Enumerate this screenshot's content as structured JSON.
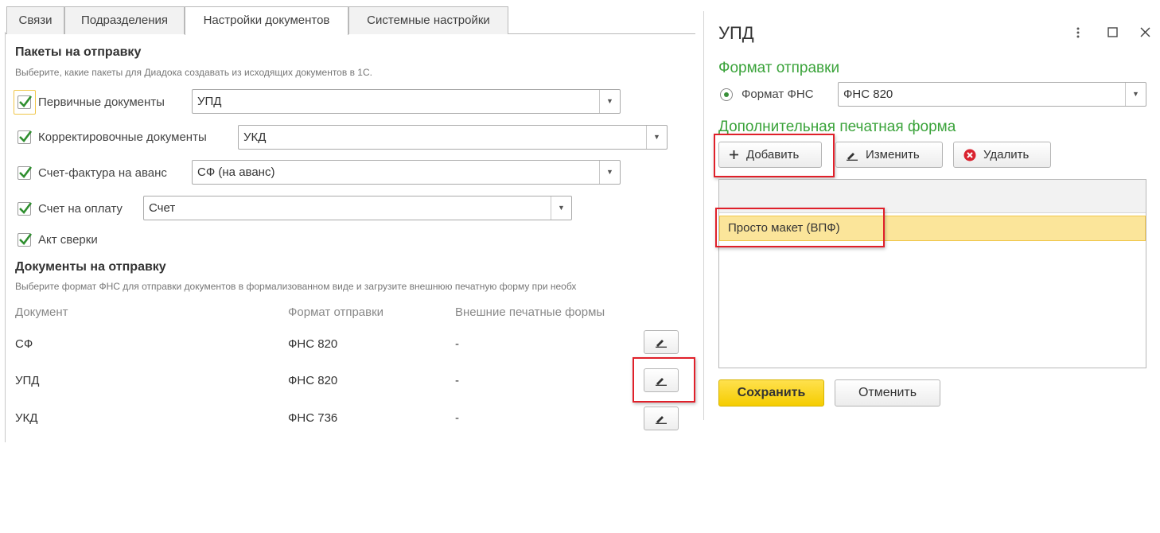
{
  "left": {
    "tabs": [
      {
        "label": "Связи",
        "active": false
      },
      {
        "label": "Подразделения",
        "active": false
      },
      {
        "label": "Настройки документов",
        "active": true
      },
      {
        "label": "Системные настройки",
        "active": false
      }
    ],
    "packages": {
      "title": "Пакеты на отправку",
      "hint": "Выберите, какие пакеты для Диадока создавать из исходящих документов в 1С.",
      "items": [
        {
          "label": "Первичные документы",
          "checked": true,
          "value": "УПД"
        },
        {
          "label": "Корректировочные документы",
          "checked": true,
          "value": "УКД"
        },
        {
          "label": "Счет-фактура на аванс",
          "checked": true,
          "value": "СФ (на аванс)"
        },
        {
          "label": "Счет на оплату",
          "checked": true,
          "value": "Счет"
        },
        {
          "label": "Акт сверки",
          "checked": true
        }
      ]
    },
    "documents": {
      "title": "Документы на отправку",
      "hint": "Выберите формат ФНС для отправки документов в формализованном виде и загрузите внешнюю печатную форму при необх",
      "columns": [
        "Документ",
        "Формат отправки",
        "Внешние печатные формы"
      ],
      "rows": [
        {
          "document": "СФ",
          "format": "ФНС 820",
          "forms": "-"
        },
        {
          "document": "УПД",
          "format": "ФНС 820",
          "forms": "-"
        },
        {
          "document": "УКД",
          "format": "ФНС 736",
          "forms": "-"
        }
      ]
    }
  },
  "dialog": {
    "title": "УПД",
    "format_section": "Формат отправки",
    "format_radio_label": "Формат ФНС",
    "format_value": "ФНС 820",
    "print_form_section": "Дополнительная печатная форма",
    "buttons": {
      "add": "Добавить",
      "edit": "Изменить",
      "delete": "Удалить"
    },
    "list_items": [
      "Просто макет (ВПФ)"
    ],
    "save": "Сохранить",
    "cancel": "Отменить"
  },
  "colors": {
    "accent_green": "#3aa33a",
    "highlight_red": "#e0202a",
    "selection_yellow": "#fbe59a",
    "save_yellow": "#f5cc00"
  }
}
